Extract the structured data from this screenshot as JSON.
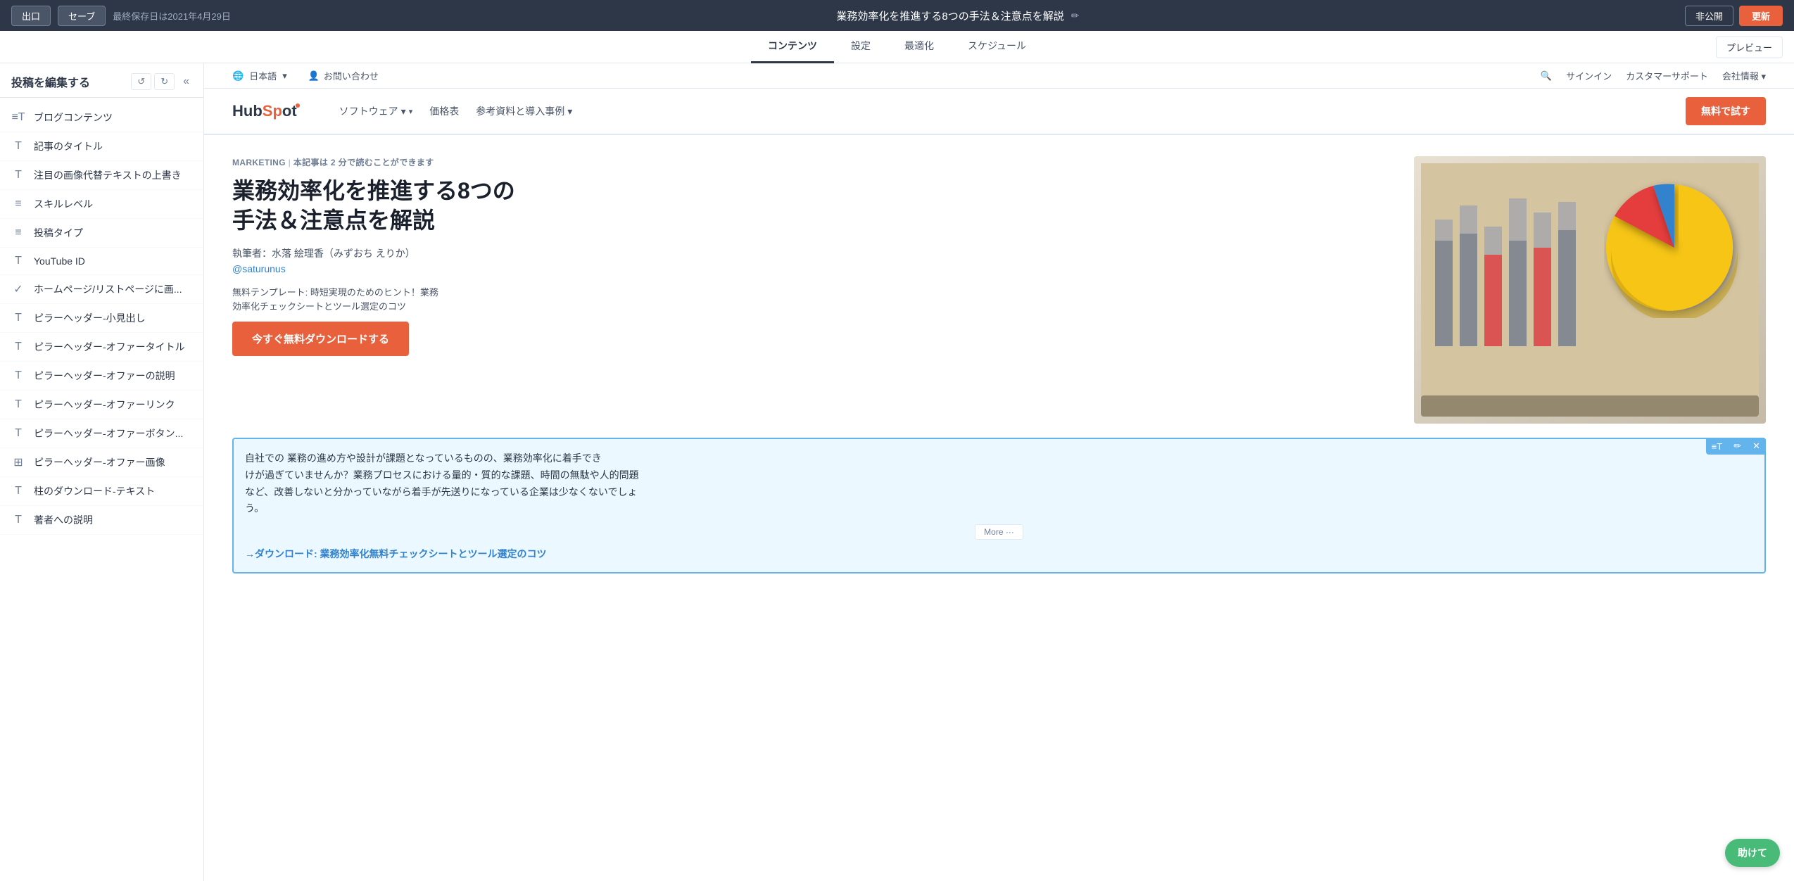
{
  "topBar": {
    "exitLabel": "出口",
    "saveLabel": "セーブ",
    "lastSaved": "最終保存日は2021年4月29日",
    "title": "業務効率化を推進する8つの手法＆注意点を解説",
    "unpublishLabel": "非公開",
    "updateLabel": "更新"
  },
  "navTabs": {
    "tabs": [
      {
        "id": "content",
        "label": "コンテンツ",
        "active": true
      },
      {
        "id": "settings",
        "label": "設定",
        "active": false
      },
      {
        "id": "optimize",
        "label": "最適化",
        "active": false
      },
      {
        "id": "schedule",
        "label": "スケジュール",
        "active": false
      }
    ],
    "previewLabel": "プレビュー"
  },
  "sidebar": {
    "title": "投稿を編集する",
    "collapseIcon": "«",
    "undoIcon": "↺",
    "redoIcon": "↻",
    "items": [
      {
        "id": "blog-content",
        "icon": "≡T",
        "label": "ブログコンテンツ"
      },
      {
        "id": "article-title",
        "icon": "T",
        "label": "記事のタイトル"
      },
      {
        "id": "image-alt",
        "icon": "T",
        "label": "注目の画像代替テキストの上書き"
      },
      {
        "id": "skill-level",
        "icon": "≡≡",
        "label": "スキルレベル"
      },
      {
        "id": "post-type",
        "icon": "≡≡",
        "label": "投稿タイプ"
      },
      {
        "id": "youtube-id",
        "icon": "T",
        "label": "YouTube ID"
      },
      {
        "id": "homepage-list",
        "icon": "✓",
        "label": "ホームページ/リストページに画..."
      },
      {
        "id": "pillar-subheading",
        "icon": "T",
        "label": "ピラーヘッダー-小見出し"
      },
      {
        "id": "pillar-offer-title",
        "icon": "T",
        "label": "ピラーヘッダー-オファータイトル"
      },
      {
        "id": "pillar-offer-desc",
        "icon": "T",
        "label": "ピラーヘッダー-オファーの説明"
      },
      {
        "id": "pillar-offer-link",
        "icon": "T",
        "label": "ピラーヘッダー-オファーリンク"
      },
      {
        "id": "pillar-offer-btn",
        "icon": "T",
        "label": "ピラーヘッダー-オファーボタン..."
      },
      {
        "id": "pillar-offer-image",
        "icon": "⊞",
        "label": "ピラーヘッダー-オファー画像"
      },
      {
        "id": "pillar-download-text",
        "icon": "T",
        "label": "柱のダウンロード-テキスト"
      },
      {
        "id": "more-items",
        "icon": "T",
        "label": "著者への説明"
      }
    ]
  },
  "siteHeader": {
    "language": "日本語",
    "contact": "お問い合わせ",
    "signIn": "サインイン",
    "customerSupport": "カスタマーサポート",
    "companyInfo": "会社情報",
    "logoHub": "HubSp",
    "logoSpot": "t",
    "navLinks": [
      {
        "label": "ソフトウェア",
        "hasDropdown": true
      },
      {
        "label": "価格表",
        "hasDropdown": false
      },
      {
        "label": "参考資料と導入事例",
        "hasDropdown": true
      }
    ],
    "ctaLabel": "無料で試す"
  },
  "blogPost": {
    "category": "MARKETING",
    "readTime": "本記事は 2 分で読むことができます",
    "title": "業務効率化を推進する8つの\n手法＆注意点を解説",
    "authorLabel": "執筆者：水落 絵理香（みずおち えりか）",
    "authorLink": "@saturunus",
    "ctaText": "無料テンプレート: 時短実現のためのヒント！業務\n効率化チェックシートとツール選定のコツ",
    "downloadBtn": "今すぐ無料ダウンロードする",
    "bodyText": "自社での 業務の進め方や設計が課題となっているものの、業務効率化に着手でき\nけが過ぎていませんか？業務プロセスにおける量的・質的な課題、時間の無駄や人的問題\nなど、改善しないと分かっていながら着手が先送りになっている企業は少なくないでしょ\nう。",
    "moreLabel": "More ···",
    "bodyLink": "→ダウンロード: 業務効率化無料チェックシートとツール選定のコツ"
  },
  "helpBtn": "助けて",
  "icons": {
    "pencil": "✏",
    "search": "🔍",
    "globe": "🌐",
    "user": "👤",
    "chevron": "▾",
    "undo": "↺",
    "redo": "↻",
    "collapse": "«",
    "check": "✓",
    "grid": "⊞",
    "textBlock": "≡T",
    "text": "T",
    "list": "≡"
  }
}
